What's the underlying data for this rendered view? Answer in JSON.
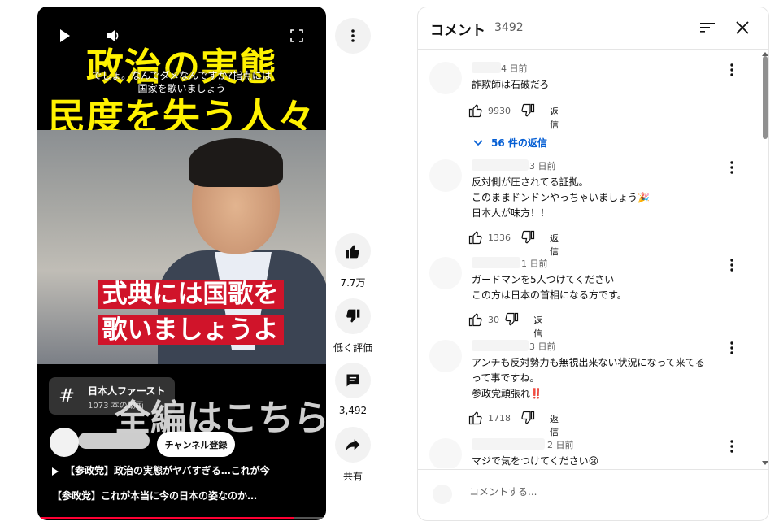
{
  "video": {
    "overlay_title_line1": "政治の実態",
    "overlay_title_line2": "民度を失う人々",
    "overlay_caption_line1": "でしょ。なんでダメなんですか?指点には",
    "overlay_caption_line2": "国家を歌いましょう",
    "subtitle_line1": "式典には国歌を",
    "subtitle_line2": "歌いましょうよ",
    "overlay_text": "全編はこちら",
    "hashtag_symbol": "#",
    "hashtag_name": "日本人ファースト",
    "hashtag_count": "1073 本の動画",
    "subscribe_label": "チャンネル登録",
    "title": "【参政党】政治の実態がヤバすぎる…これが今",
    "title_next": "【参政党】これが本当に今の日本の姿なのか…",
    "progress": 0.89
  },
  "actions": {
    "like_count": "7.7万",
    "dislike_label": "低く評価",
    "comment_count": "3,492",
    "share_label": "共有"
  },
  "comments_panel": {
    "title": "コメント",
    "count": "3492",
    "input_placeholder": "コメントする...",
    "reply_label": "返信",
    "items": [
      {
        "time": "4 日前",
        "lines": [
          "詐欺師は石破だろ"
        ],
        "likes": "9930",
        "replies_toggle": "56 件の返信"
      },
      {
        "time": "3 日前",
        "lines": [
          "反対側が圧されてる証拠。",
          "このままドンドンやっちゃいましょう🎉",
          "日本人が味方！！"
        ],
        "likes": "1336"
      },
      {
        "time": "1 日前",
        "lines": [
          "ガードマンを5人つけてください",
          "この方は日本の首相になる方です。"
        ],
        "likes": "30"
      },
      {
        "time": "3 日前",
        "lines": [
          "アンチも反対勢力も無視出来ない状況になって来てる",
          "って事ですね。",
          "参政党頑張れ‼️"
        ],
        "likes": "1718"
      },
      {
        "time": "2 日前",
        "lines": [
          "マジで気をつけてください😢"
        ]
      }
    ]
  },
  "colors": {
    "title_yellow": "#fff200",
    "subtitle_red": "#d0142a",
    "link_blue": "#065fd4",
    "progress_red": "#ff0033"
  }
}
